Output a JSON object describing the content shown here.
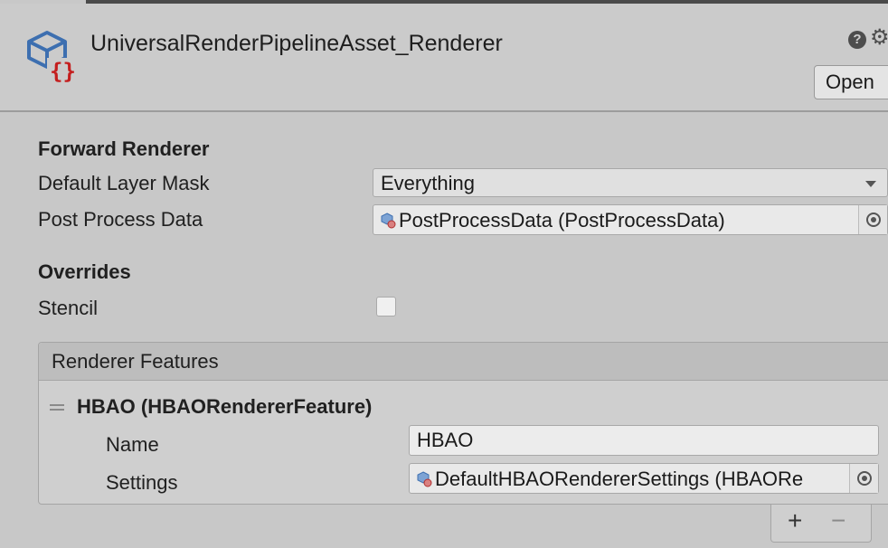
{
  "header": {
    "title": "UniversalRenderPipelineAsset_Renderer",
    "help_icon": "?",
    "settings_icon": "gear-icon",
    "open_label": "Open"
  },
  "forward_renderer": {
    "section_title": "Forward Renderer",
    "default_layer_mask": {
      "label": "Default Layer Mask",
      "value": "Everything"
    },
    "post_process_data": {
      "label": "Post Process Data",
      "value": "PostProcessData (PostProcessData)"
    }
  },
  "overrides": {
    "section_title": "Overrides",
    "stencil": {
      "label": "Stencil",
      "checked": false
    }
  },
  "renderer_features": {
    "header": "Renderer Features",
    "items": [
      {
        "title": "HBAO (HBAORendererFeature)",
        "name": {
          "label": "Name",
          "value": "HBAO"
        },
        "settings": {
          "label": "Settings",
          "value": "DefaultHBAORendererSettings (HBAORe"
        }
      }
    ],
    "add_label": "+",
    "remove_label": "−"
  },
  "colors": {
    "panel_bg": "#c8c8c8",
    "asset_icon_blue": "#3d6fb0",
    "asset_icon_red": "#c41e1e"
  }
}
